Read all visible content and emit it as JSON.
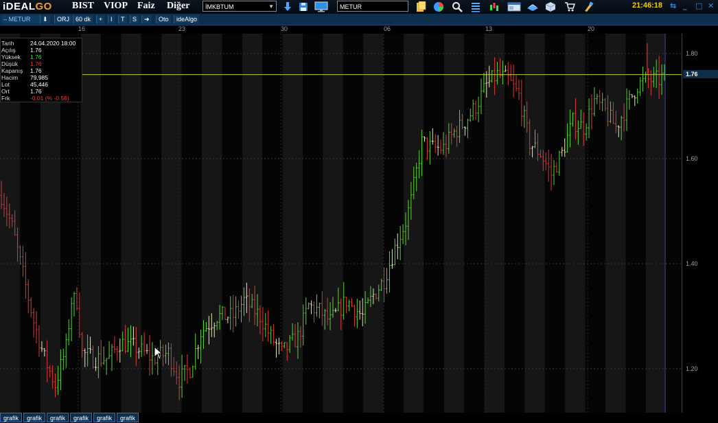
{
  "topbar": {
    "logo_main": "iDEAL",
    "logo_accent": "GO",
    "menu": [
      "BIST",
      "VIOP",
      "Faiz",
      "Diğer"
    ],
    "market_select": "İMKBTUM",
    "symbol_input": "METUR",
    "clock": "21:46:18",
    "icons": [
      "download-icon",
      "save-icon",
      "monitor-icon",
      "clipboard-icon",
      "pie-chart-icon",
      "search-icon",
      "list-icon",
      "candles-icon",
      "window-icon",
      "satellite-icon",
      "cube-icon",
      "cart-icon",
      "brush-icon"
    ]
  },
  "toolbar": {
    "symbol": "METUR",
    "buttons": [
      "ORJ",
      "60 dk",
      "+",
      "I",
      "T",
      "S",
      "➜",
      "Oto",
      "ideAlgo"
    ]
  },
  "x_axis": {
    "labels": [
      "16",
      "23",
      "30",
      "06",
      "13",
      "20"
    ]
  },
  "y_axis": {
    "labels": [
      "1.80",
      "1.60",
      "1.40",
      "1.20"
    ],
    "current": "1.76"
  },
  "info_box": {
    "rows": [
      {
        "key": "Tarih",
        "value": "24.04.2020 18:00",
        "color": "#ffffff"
      },
      {
        "key": "Açılış",
        "value": "1.76",
        "color": "#ffffff"
      },
      {
        "key": "Yüksek",
        "value": "1.76",
        "color": "#3ee24a"
      },
      {
        "key": "Düşük",
        "value": "1.76",
        "color": "#ff3b3b"
      },
      {
        "key": "Kapanış",
        "value": "1.76",
        "color": "#ffffff"
      },
      {
        "key": "Hacim",
        "value": "79,985",
        "color": "#ffffff"
      },
      {
        "key": "Lot",
        "value": "45,446",
        "color": "#ffffff"
      },
      {
        "key": "Ort",
        "value": "1.76",
        "color": "#ffffff"
      },
      {
        "key": "Frk",
        "value": "-0.01 (% -0.56)",
        "color": "#ff3b3b"
      }
    ]
  },
  "bottom_tabs": [
    "grafik",
    "grafik",
    "grafik",
    "grafik",
    "grafik",
    "grafik"
  ],
  "colors": {
    "up": "#5cd43a",
    "down": "#e03a3a",
    "neutral": "#e8e8c0",
    "hline": "#b8d040",
    "panel": "#0f2e4c"
  },
  "chart_data": {
    "type": "ohlc",
    "symbol": "METUR",
    "interval": "60 dk",
    "x_ticks": [
      "16",
      "23",
      "30",
      "06",
      "13",
      "20"
    ],
    "y_ticks": [
      1.8,
      1.6,
      1.4,
      1.2
    ],
    "ylim": [
      1.13,
      1.85
    ],
    "last_price": 1.76,
    "close_path": [
      {
        "bar": 0,
        "close": 1.53
      },
      {
        "bar": 4,
        "close": 1.47
      },
      {
        "bar": 8,
        "close": 1.38
      },
      {
        "bar": 12,
        "close": 1.29
      },
      {
        "bar": 16,
        "close": 1.22
      },
      {
        "bar": 20,
        "close": 1.17
      },
      {
        "bar": 24,
        "close": 1.24
      },
      {
        "bar": 26,
        "close": 1.33
      },
      {
        "bar": 28,
        "close": 1.33
      },
      {
        "bar": 30,
        "close": 1.23
      },
      {
        "bar": 34,
        "close": 1.22
      },
      {
        "bar": 40,
        "close": 1.22
      },
      {
        "bar": 44,
        "close": 1.25
      },
      {
        "bar": 50,
        "close": 1.24
      },
      {
        "bar": 56,
        "close": 1.22
      },
      {
        "bar": 62,
        "close": 1.23
      },
      {
        "bar": 66,
        "close": 1.18
      },
      {
        "bar": 70,
        "close": 1.2
      },
      {
        "bar": 74,
        "close": 1.27
      },
      {
        "bar": 80,
        "close": 1.3
      },
      {
        "bar": 86,
        "close": 1.3
      },
      {
        "bar": 90,
        "close": 1.33
      },
      {
        "bar": 96,
        "close": 1.3
      },
      {
        "bar": 100,
        "close": 1.26
      },
      {
        "bar": 104,
        "close": 1.23
      },
      {
        "bar": 110,
        "close": 1.26
      },
      {
        "bar": 114,
        "close": 1.32
      },
      {
        "bar": 118,
        "close": 1.31
      },
      {
        "bar": 122,
        "close": 1.29
      },
      {
        "bar": 128,
        "close": 1.33
      },
      {
        "bar": 134,
        "close": 1.3
      },
      {
        "bar": 138,
        "close": 1.34
      },
      {
        "bar": 142,
        "close": 1.37
      },
      {
        "bar": 146,
        "close": 1.43
      },
      {
        "bar": 150,
        "close": 1.48
      },
      {
        "bar": 152,
        "close": 1.52
      },
      {
        "bar": 156,
        "close": 1.63
      },
      {
        "bar": 160,
        "close": 1.62
      },
      {
        "bar": 164,
        "close": 1.62
      },
      {
        "bar": 168,
        "close": 1.65
      },
      {
        "bar": 172,
        "close": 1.67
      },
      {
        "bar": 176,
        "close": 1.7
      },
      {
        "bar": 180,
        "close": 1.74
      },
      {
        "bar": 184,
        "close": 1.76
      },
      {
        "bar": 188,
        "close": 1.75
      },
      {
        "bar": 192,
        "close": 1.72
      },
      {
        "bar": 196,
        "close": 1.63
      },
      {
        "bar": 200,
        "close": 1.61
      },
      {
        "bar": 204,
        "close": 1.57
      },
      {
        "bar": 208,
        "close": 1.61
      },
      {
        "bar": 212,
        "close": 1.67
      },
      {
        "bar": 216,
        "close": 1.66
      },
      {
        "bar": 220,
        "close": 1.71
      },
      {
        "bar": 224,
        "close": 1.69
      },
      {
        "bar": 228,
        "close": 1.66
      },
      {
        "bar": 232,
        "close": 1.7
      },
      {
        "bar": 236,
        "close": 1.74
      },
      {
        "bar": 240,
        "close": 1.75
      },
      {
        "bar": 244,
        "close": 1.75
      },
      {
        "bar": 246,
        "close": 1.76
      }
    ]
  }
}
